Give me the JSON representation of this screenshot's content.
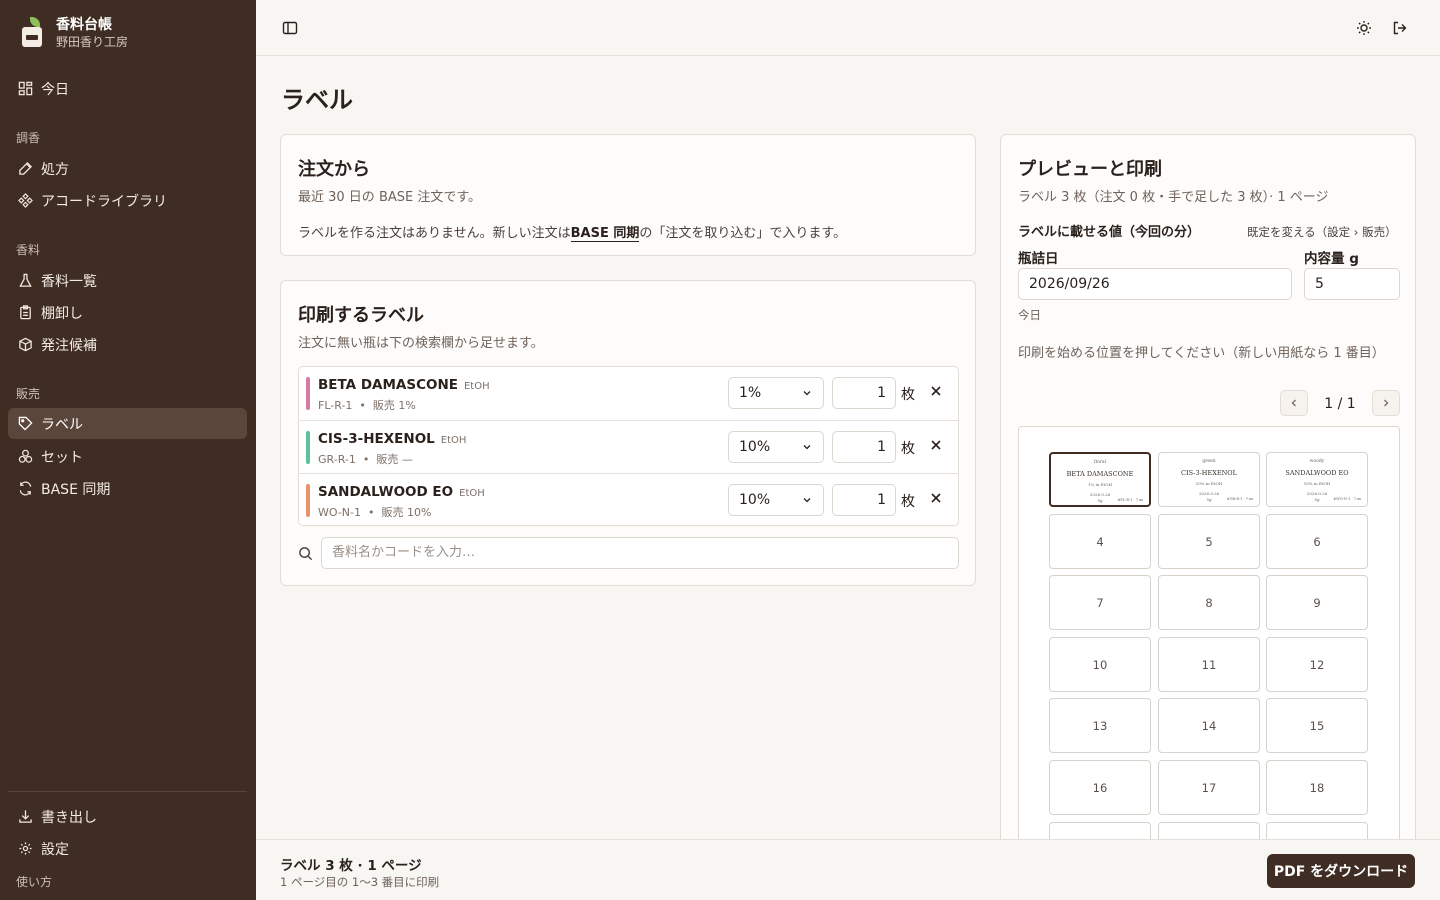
{
  "app": {
    "title": "香料台帳",
    "workshop": "野田香り工房"
  },
  "sidebar": {
    "today": "今日",
    "sections": [
      {
        "label": "調香",
        "items": [
          "処方",
          "アコードライブラリ"
        ]
      },
      {
        "label": "香料",
        "items": [
          "香料一覧",
          "棚卸し",
          "発注候補"
        ]
      },
      {
        "label": "販売",
        "items": [
          "ラベル",
          "セット",
          "BASE 同期"
        ]
      }
    ],
    "bottom": [
      "書き出し",
      "設定"
    ],
    "help": "使い方"
  },
  "page": {
    "title": "ラベル"
  },
  "orders": {
    "title": "注文から",
    "subtitle": "最近 30 日の BASE 注文です。",
    "empty_pre": "ラベルを作る注文はありません。新しい注文は",
    "empty_link": "BASE 同期",
    "empty_post": "の「注文を取り込む」で入ります。"
  },
  "print_labels": {
    "title": "印刷するラベル",
    "subtitle": "注文に無い瓶は下の検索欄から足せます。",
    "unit": "枚",
    "rows": [
      {
        "name": "BETA DAMASCONE",
        "solvent": "EtOH",
        "code": "FL-R-1",
        "sale": "販売 1%",
        "conc": "1%",
        "qty": "1",
        "color": "#d97aa5"
      },
      {
        "name": "CIS-3-HEXENOL",
        "solvent": "EtOH",
        "code": "GR-R-1",
        "sale": "販売 —",
        "conc": "10%",
        "qty": "1",
        "color": "#5cc29a"
      },
      {
        "name": "SANDALWOOD EO",
        "solvent": "EtOH",
        "code": "WO-N-1",
        "sale": "販売 10%",
        "conc": "10%",
        "qty": "1",
        "color": "#e8936a"
      }
    ],
    "search_placeholder": "香料名かコードを入力…"
  },
  "preview": {
    "title": "プレビューと印刷",
    "summary": "ラベル 3 枚（注文 0 枚・手で足した 3 枚）· 1 ページ",
    "values_heading": "ラベルに載せる値（今回の分）",
    "defaults_link": "既定を変える（設定 › 販売）",
    "date_label": "瓶詰日",
    "date_value": "2026/09/26",
    "date_hint": "今日",
    "volume_label": "内容量 g",
    "volume_value": "5",
    "start_prompt": "印刷を始める位置を押してください（新しい用紙なら 1 番目）",
    "page_indicator": "1 / 1",
    "filled_cells": [
      {
        "family": "floral",
        "name": "BETA DAMASCONE",
        "sub": "1% in EtOH",
        "date": "2026.9.26",
        "qty": "5g",
        "batch": "#FL-R-1 · 7.xx"
      },
      {
        "family": "green",
        "name": "CIS-3-HEXENOL",
        "sub": "10% in EtOH",
        "date": "2026.9.26",
        "qty": "5g",
        "batch": "#GR-R-1 · 7.xx"
      },
      {
        "family": "woody",
        "name": "SANDALWOOD EO",
        "sub": "10% in EtOH",
        "date": "2026.9.26",
        "qty": "5g",
        "batch": "#WO-N-1 · 7.xx"
      }
    ],
    "empty_cells": [
      "4",
      "5",
      "6",
      "7",
      "8",
      "9",
      "10",
      "11",
      "12",
      "13",
      "14",
      "15",
      "16",
      "17",
      "18"
    ]
  },
  "footer": {
    "summary": "ラベル 3 枚 · 1 ページ",
    "detail": "1 ページ目の 1〜3 番目に印刷",
    "download": "PDF をダウンロード"
  }
}
